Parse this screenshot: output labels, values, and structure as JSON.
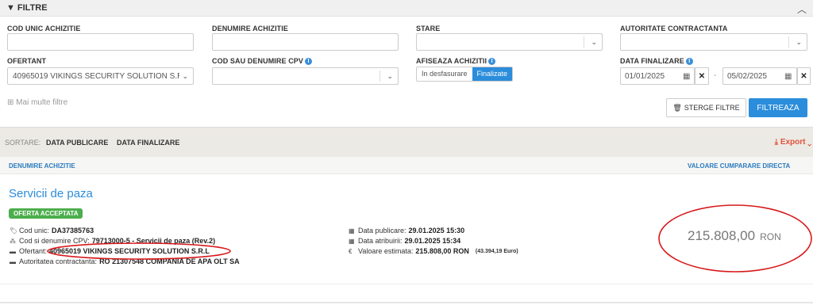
{
  "filters": {
    "title": "FILTRE",
    "cod_unic_label": "COD UNIC ACHIZITIE",
    "cod_unic_value": "",
    "denumire_label": "DENUMIRE ACHIZITIE",
    "denumire_value": "",
    "stare_label": "STARE",
    "stare_value": "",
    "autoritate_label": "AUTORITATE CONTRACTANTA",
    "autoritate_value": "",
    "ofertant_label": "OFERTANT",
    "ofertant_value": "40965019 VIKINGS SECURITY SOLUTION S.R.L",
    "cpv_label": "COD SAU DENUMIRE CPV",
    "cpv_value": "",
    "afiseaza_label": "AFISEAZA ACHIZITII",
    "afiseaza_options": [
      "In desfasurare",
      "Finalizate"
    ],
    "afiseaza_selected": "Finalizate",
    "data_label": "DATA FINALIZARE",
    "data_from": "01/01/2025",
    "data_to": "05/02/2025",
    "more_filters": "Mai multe filtre",
    "clear_button": "STERGE FILTRE",
    "search_button": "FILTREAZA"
  },
  "sorting": {
    "label": "SORTARE:",
    "options": [
      "DATA PUBLICARE",
      "DATA FINALIZARE"
    ],
    "export": "Export"
  },
  "columns": {
    "left": "DENUMIRE ACHIZITIE",
    "right": "VALOARE CUMPARARE DIRECTA"
  },
  "result": {
    "title": "Servicii de paza",
    "badge": "OFERTA ACCEPTATA",
    "cod_unic_label": "Cod unic:",
    "cod_unic_value": "DA37385763",
    "cpv_label": "Cod si denumire CPV:",
    "cpv_value": "79713000-5 - Servicii de paza (Rev.2)",
    "ofertant_label": "Ofertant:",
    "ofertant_value": "40965019 VIKINGS SECURITY SOLUTION S.R.L",
    "autoritate_label": "Autoritatea contractanta:",
    "autoritate_value": "RO 21307548 COMPANIA DE APA OLT SA",
    "publicare_label": "Data publicare:",
    "publicare_value": "29.01.2025 15:30",
    "atribuire_label": "Data atribuirii:",
    "atribuire_value": "29.01.2025 15:34",
    "estimata_label": "Valoare estimata:",
    "estimata_value": "215.808,00 RON",
    "estimata_euro": "(43.394,19 Euro)",
    "value": "215.808,00",
    "currency": "RON"
  },
  "colors": {
    "accent": "#2b8ddb",
    "badge": "#4cae4c",
    "export": "#e0533c"
  }
}
